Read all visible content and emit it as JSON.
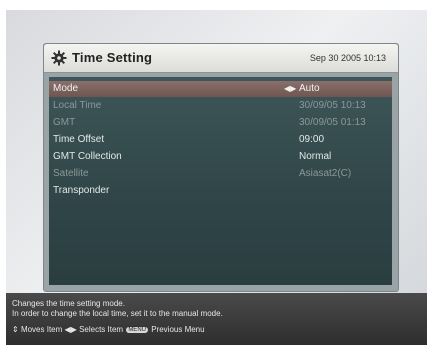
{
  "header": {
    "title": "Time Setting",
    "datetime": "Sep 30 2005 10:13",
    "icon": "gear-icon"
  },
  "rows": [
    {
      "label": "Mode",
      "value": "Auto",
      "selected": true,
      "enabled": true
    },
    {
      "label": "Local Time",
      "value": "30/09/05 10:13",
      "selected": false,
      "enabled": false
    },
    {
      "label": "GMT",
      "value": "30/09/05 01:13",
      "selected": false,
      "enabled": false
    },
    {
      "label": "Time Offset",
      "value": "09:00",
      "selected": false,
      "enabled": true
    },
    {
      "label": "GMT Collection",
      "value": "Normal",
      "selected": false,
      "enabled": true
    },
    {
      "label": "Satellite",
      "value": "Asiasat2(C)",
      "selected": false,
      "enabled": false
    },
    {
      "label": "Transponder",
      "value": "",
      "selected": false,
      "enabled": true
    }
  ],
  "footer": {
    "help_line1": "Changes the time setting mode.",
    "help_line2": "In order to change the local time, set it to the manual mode.",
    "moves_label": "Moves Item",
    "selects_label": "Selects Item",
    "menu_key": "MENU",
    "previous_label": "Previous Menu"
  },
  "colors": {
    "selected_row": "#7d6460",
    "panel_body": "#34494b",
    "footer_bg": "#3a3a3a"
  }
}
